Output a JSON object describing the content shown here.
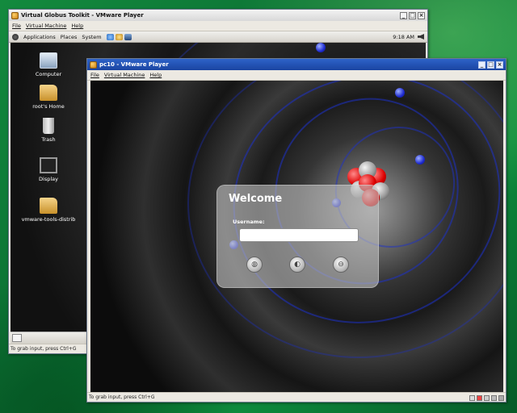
{
  "window1": {
    "title": "Virtual Globus Toolkit - VMware Player",
    "menu": [
      "File",
      "Virtual Machine",
      "Help"
    ],
    "panel": {
      "applications": "Applications",
      "places": "Places",
      "system": "System",
      "clock": "9:18 AM"
    },
    "desktop_icons": [
      {
        "label": "Computer",
        "icon": "computer-icon"
      },
      {
        "label": "root's Home",
        "icon": "home-folder-icon"
      },
      {
        "label": "Trash",
        "icon": "trash-icon"
      },
      {
        "label": "Display",
        "icon": "display-icon"
      },
      {
        "label": "vmware-tools-distrib",
        "icon": "folder-icon"
      }
    ],
    "status": "To grab input, press Ctrl+G"
  },
  "window2": {
    "title": "pc10 - VMware Player",
    "menu": [
      "File",
      "Virtual Machine",
      "Help"
    ],
    "login": {
      "title": "Welcome",
      "username_label": "Username:",
      "username_value": "",
      "buttons": [
        "language-icon",
        "session-icon",
        "shutdown-icon"
      ]
    },
    "status": "To grab input, press Ctrl+G"
  },
  "colors": {
    "host_background": "#0b7a3a",
    "active_titlebar": "#1b45a1",
    "electron": "#1e2bd0",
    "nucleus_red": "#d00000"
  }
}
